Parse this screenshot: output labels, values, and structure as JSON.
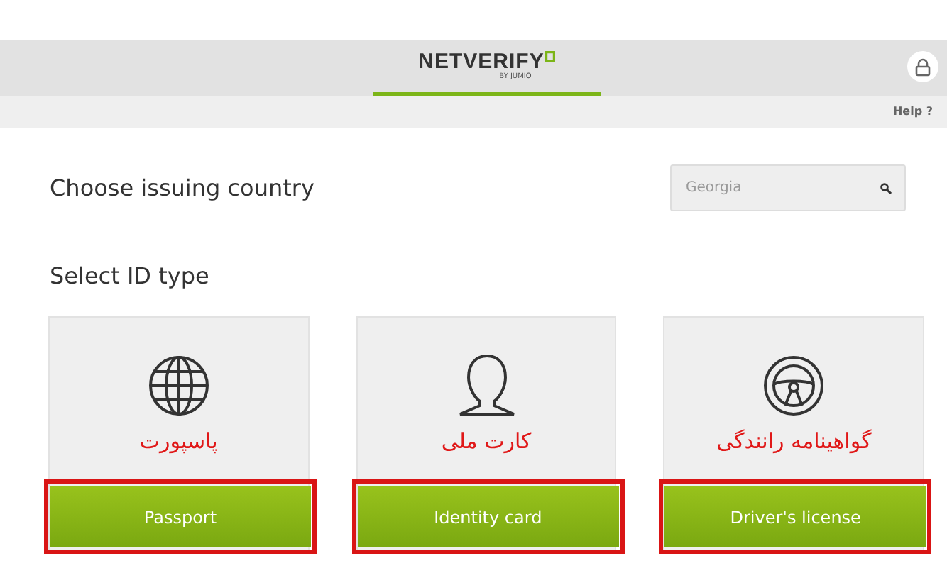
{
  "header": {
    "logo": "NETVERIFY",
    "logo_sub": "BY JUMIO"
  },
  "subheader": {
    "help": "Help ?"
  },
  "country": {
    "label": "Choose issuing country",
    "search_value": "Georgia"
  },
  "id_section": {
    "label": "Select ID type"
  },
  "id_types": [
    {
      "kind": "globe",
      "button": "Passport"
    },
    {
      "kind": "person",
      "button": "Identity card"
    },
    {
      "kind": "wheel",
      "button": "Driver's license"
    }
  ],
  "annotations_rtl": [
    "گواهینامه رانندگی",
    "کارت ملی",
    "پاسپورت"
  ]
}
